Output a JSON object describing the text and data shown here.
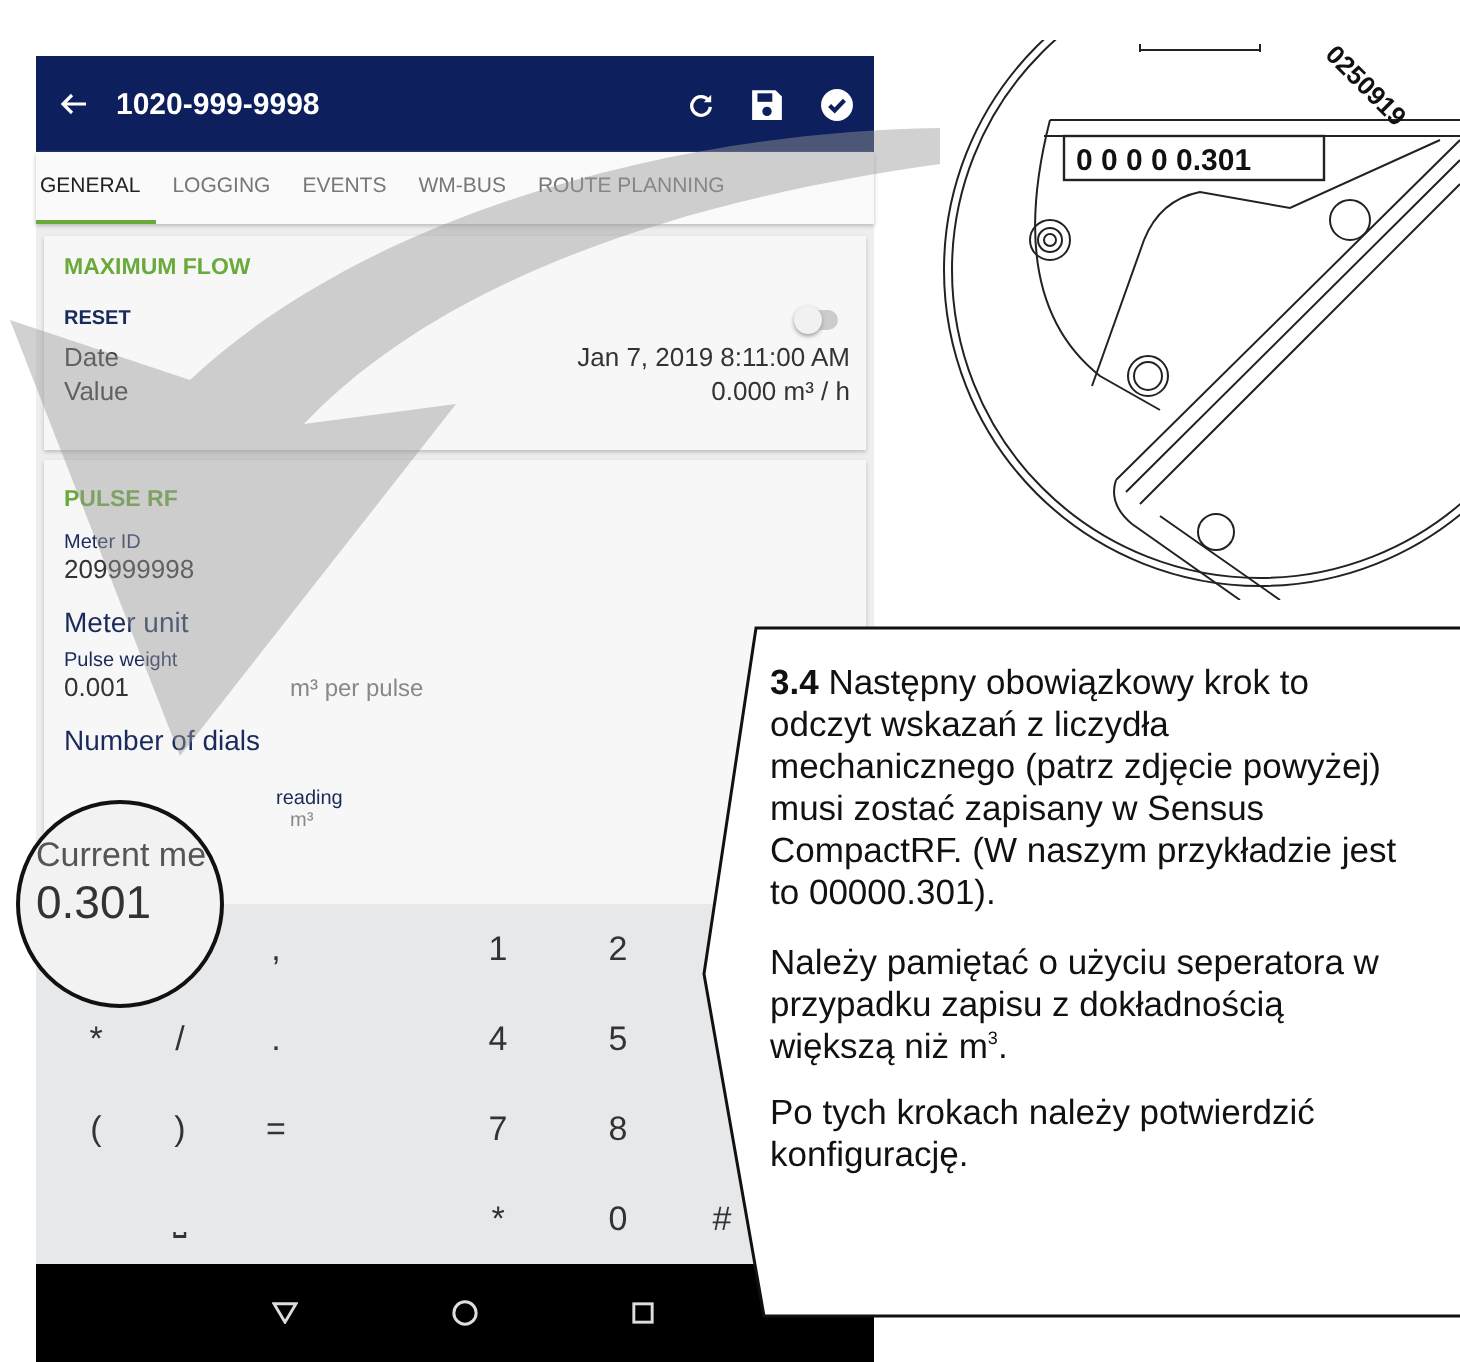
{
  "app_bar": {
    "title": "1020-999-9998"
  },
  "tabs": [
    {
      "label": "GENERAL",
      "selected": true
    },
    {
      "label": "LOGGING",
      "selected": false
    },
    {
      "label": "EVENTS",
      "selected": false
    },
    {
      "label": "WM-BUS",
      "selected": false
    },
    {
      "label": "ROUTE PLANNING",
      "selected": false
    }
  ],
  "maximum_flow": {
    "title": "MAXIMUM FLOW",
    "reset_label": "RESET",
    "reset_on": false,
    "rows": [
      {
        "label": "Date",
        "value": "Jan 7, 2019 8:11:00 AM"
      },
      {
        "label": "Value",
        "value": "0.000 m³ / h"
      }
    ]
  },
  "pulse_rf": {
    "title": "PULSE RF",
    "meter_id_label": "Meter ID",
    "meter_id": "209999998",
    "meter_unit": "Meter unit",
    "pulse_weight_label": "Pulse weight",
    "pulse_weight": "0.001",
    "pulse_weight_unit": "m³ per pulse",
    "number_of_dials": "Number of dials",
    "reading_label": "reading",
    "reading_unit": "m³"
  },
  "magnifier": {
    "label": "Current me",
    "value": "0.301"
  },
  "keypad": [
    [
      {
        "kind": "blank"
      },
      {
        "kind": "blank"
      },
      {
        "kind": "key",
        "label": ","
      },
      {
        "kind": "key",
        "label": "1"
      },
      {
        "kind": "key",
        "label": "2"
      }
    ],
    [
      {
        "kind": "key",
        "label": "*"
      },
      {
        "kind": "key",
        "label": "/"
      },
      {
        "kind": "key",
        "label": "."
      },
      {
        "kind": "key",
        "label": "4"
      },
      {
        "kind": "key",
        "label": "5"
      }
    ],
    [
      {
        "kind": "key",
        "label": "("
      },
      {
        "kind": "key",
        "label": ")"
      },
      {
        "kind": "key",
        "label": "="
      },
      {
        "kind": "key",
        "label": "7"
      },
      {
        "kind": "key",
        "label": "8"
      }
    ],
    [
      {
        "kind": "blank"
      },
      {
        "kind": "key",
        "label": "⎵"
      },
      {
        "kind": "blank"
      },
      {
        "kind": "key",
        "label": "*"
      },
      {
        "kind": "key",
        "label": "0"
      },
      {
        "kind": "key",
        "label": "#"
      }
    ]
  ],
  "meter": {
    "counter": "0 0 0 0 0.301",
    "serial": "0250919"
  },
  "callout": {
    "paragraphs": [
      "**3.4**  Następny obowiązkowy krok to odczyt wskazań z liczydła mechanicznego (patrz zdjęcie powyżej) musi zostać zapisany w Sensus CompactRF. (W naszym przykładzie jest to 00000.301).",
      "Należy pamiętać o użyciu seperatora w przypadku zapisu z dokładnością większą niż m$^{3}$.",
      "Po tych krokach należy potwierdzić konfigurację."
    ]
  }
}
